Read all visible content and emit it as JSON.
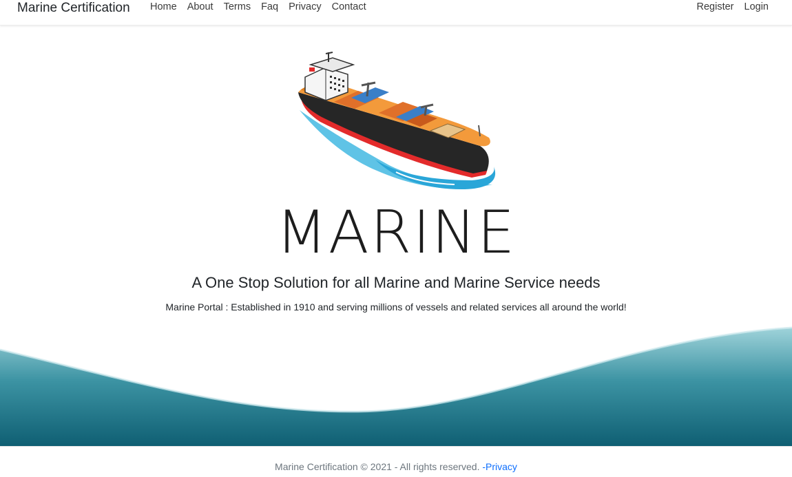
{
  "nav": {
    "brand": "Marine Certification",
    "links": [
      "Home",
      "About",
      "Terms",
      "Faq",
      "Privacy",
      "Contact"
    ],
    "auth": [
      "Register",
      "Login"
    ]
  },
  "hero": {
    "logo_text": "MARINE",
    "tagline": "A One Stop Solution for all Marine and Marine Service needs",
    "description": "Marine Portal : Established in 1910 and serving millions of vessels and related services all around the world!"
  },
  "footer": {
    "text": "Marine Certification © 2021 - All rights reserved. ",
    "link": "-Privacy"
  },
  "colors": {
    "wave_top": "#9fd3da",
    "wave_bottom": "#0f5f73",
    "link": "#0d6efd"
  }
}
